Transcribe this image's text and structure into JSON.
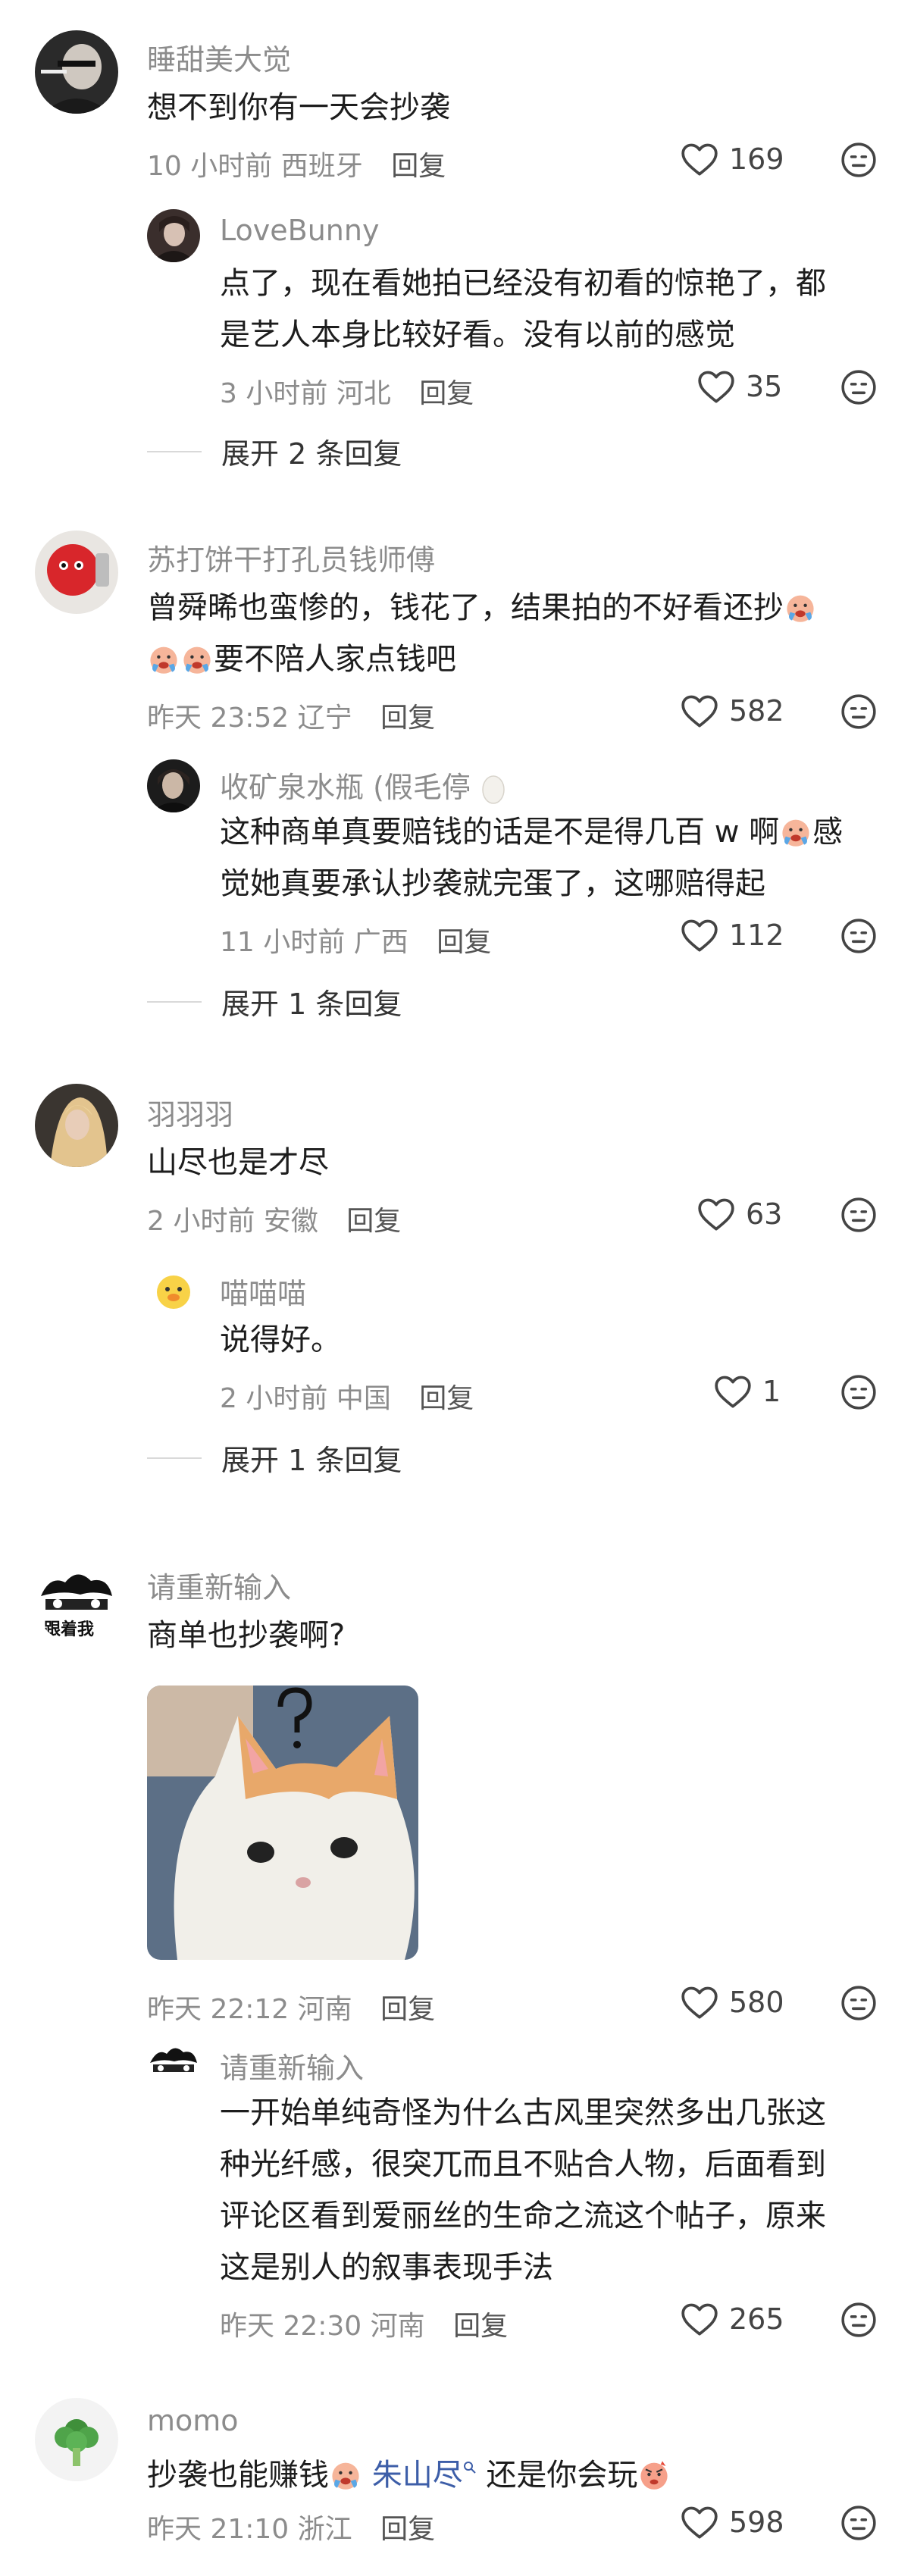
{
  "threads": [
    {
      "name": "睡甜美大觉",
      "text": "想不到你有一天会抄袭",
      "time": "10 小时前",
      "location": "西班牙",
      "reply": "回复",
      "likes": "169",
      "reply_item": {
        "name": "LoveBunny",
        "line1": "点了，现在看她拍已经没有初看的惊艳了，都",
        "line2": "是艺人本身比较好看。没有以前的感觉",
        "time": "3 小时前",
        "location": "河北",
        "reply": "回复",
        "likes": "35"
      },
      "expand": "展开 2 条回复"
    },
    {
      "name": "苏打饼干打孔员钱师傅",
      "line1": "曾舜晞也蛮惨的，钱花了，结果拍的不好看还抄",
      "line2": "要不陪人家点钱吧",
      "time": "昨天 23:52",
      "location": "辽宁",
      "reply": "回复",
      "likes": "582",
      "reply_item": {
        "name": "收矿泉水瓶 (假毛停",
        "line1a": "这种商单真要赔钱的话是不是得几百 w 啊",
        "line1b": "感",
        "line2": "觉她真要承认抄袭就完蛋了，这哪赔得起",
        "time": "11 小时前",
        "location": "广西",
        "reply": "回复",
        "likes": "112"
      },
      "expand": "展开 1 条回复"
    },
    {
      "name": "羽羽羽",
      "text": "山尽也是才尽",
      "time": "2 小时前",
      "location": "安徽",
      "reply": "回复",
      "likes": "63",
      "reply_item": {
        "name": "喵喵喵",
        "text": "说得好。",
        "time": "2 小时前",
        "location": "中国",
        "reply": "回复",
        "likes": "1"
      },
      "expand": "展开 1 条回复"
    },
    {
      "name": "请重新输入",
      "avatar_text": "跟着我",
      "text": "商单也抄袭啊?",
      "time": "昨天 22:12",
      "location": "河南",
      "reply": "回复",
      "likes": "580",
      "reply_item": {
        "name": "请重新输入",
        "line1": "一开始单纯奇怪为什么古风里突然多出几张这",
        "line2": "种光纤感，很突兀而且不贴合人物，后面看到",
        "line3": "评论区看到爱丽丝的生命之流这个帖子，原来",
        "line4": "这是别人的叙事表现手法",
        "time": "昨天 22:30",
        "location": "河南",
        "reply": "回复",
        "likes": "265"
      }
    },
    {
      "name": "momo",
      "text_a": "抄袭也能赚钱",
      "mention": "朱山尽",
      "text_b": "还是你会玩",
      "time": "昨天 21:10",
      "location": "浙江",
      "reply": "回复",
      "likes": "598"
    }
  ]
}
